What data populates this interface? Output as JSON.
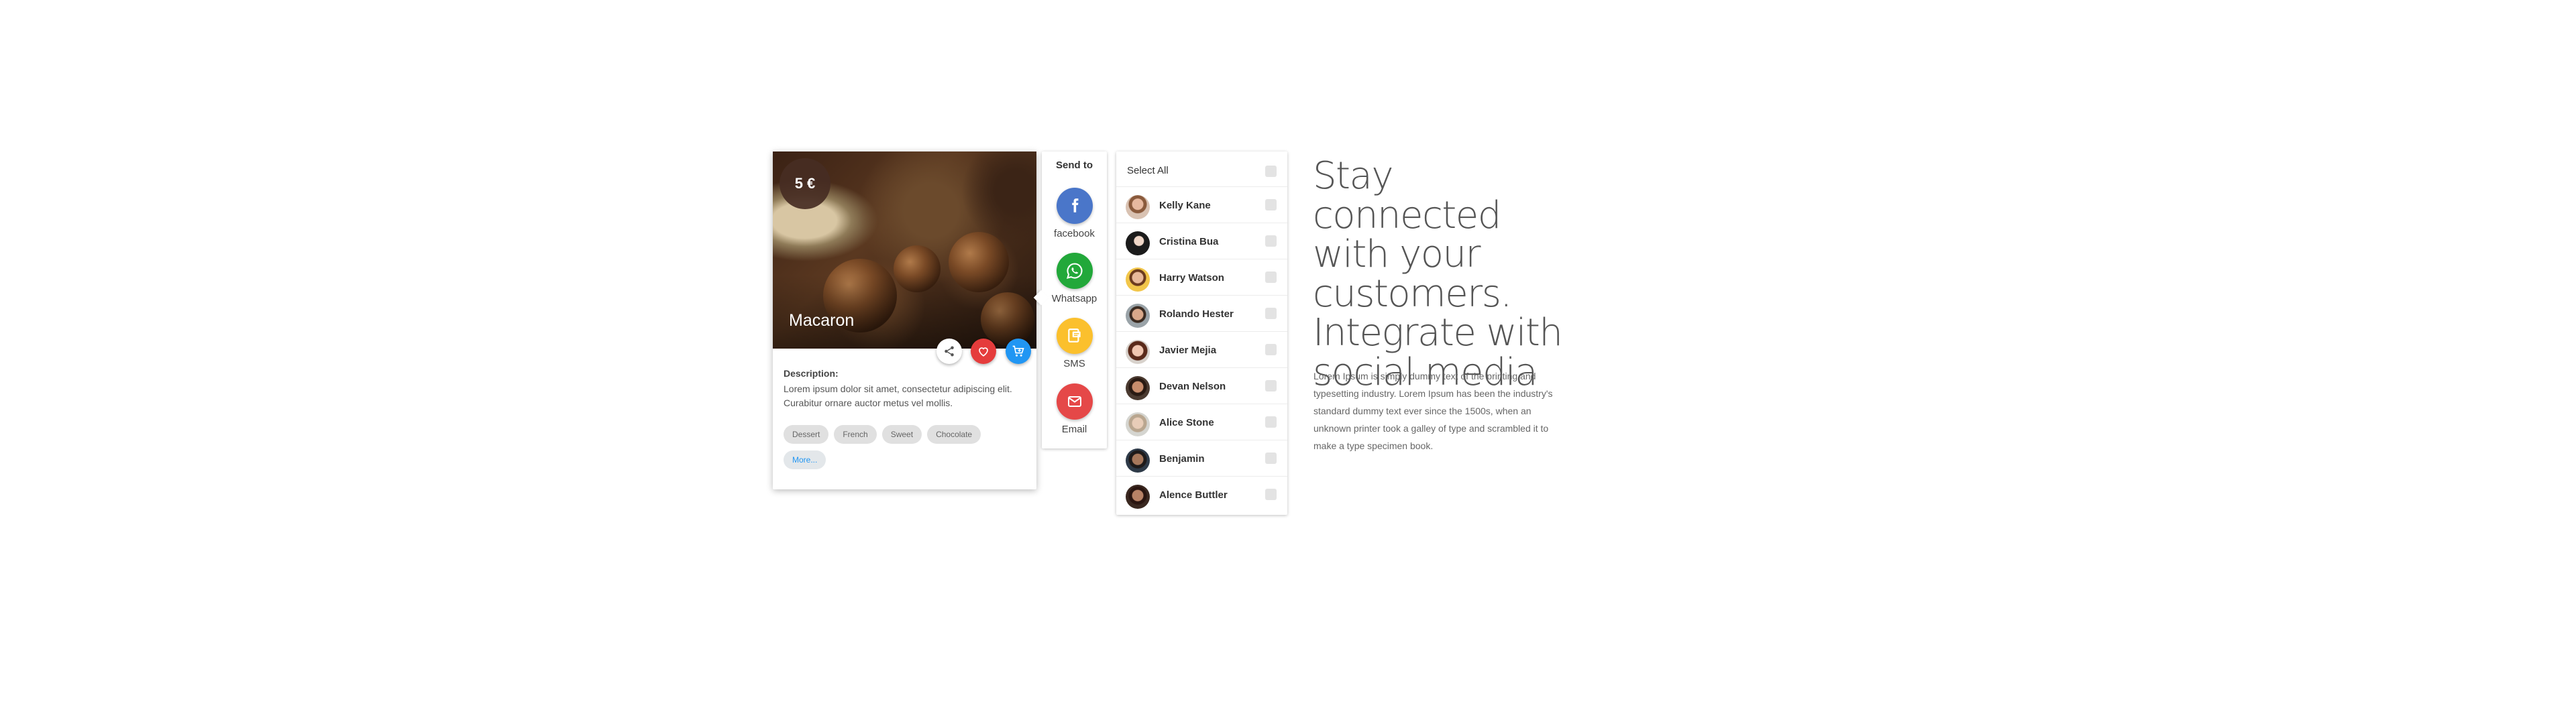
{
  "product": {
    "price": "5 €",
    "title": "Macaron",
    "description_label": "Description:",
    "description": "Lorem ipsum dolor sit amet, consectetur adipiscing elit. Curabitur ornare auctor metus vel mollis.",
    "tags": [
      "Dessert",
      "French",
      "Sweet",
      "Chocolate"
    ],
    "more_label": "More..."
  },
  "send_to": {
    "title": "Send to",
    "items": [
      {
        "label": "facebook",
        "icon": "facebook-icon",
        "color": "#4a76c9"
      },
      {
        "label": "Whatsapp",
        "icon": "whatsapp-icon",
        "color": "#22a83a"
      },
      {
        "label": "SMS",
        "icon": "sms-icon",
        "color": "#fbc02d"
      },
      {
        "label": "Email",
        "icon": "email-icon",
        "color": "#e54848"
      }
    ]
  },
  "contacts": {
    "select_all": "Select All",
    "people": [
      {
        "name": "Kelly Kane"
      },
      {
        "name": "Cristina Bua"
      },
      {
        "name": "Harry Watson"
      },
      {
        "name": "Rolando Hester"
      },
      {
        "name": "Javier Mejia"
      },
      {
        "name": "Devan Nelson"
      },
      {
        "name": "Alice Stone"
      },
      {
        "name": "Benjamin"
      },
      {
        "name": "Alence Buttler"
      }
    ]
  },
  "marketing": {
    "headline": "Stay connected with your customers. Integrate with social media",
    "body": "Lorem Ipsum is simply dummy text of the printing and typesetting industry. Lorem Ipsum has been the industry's standard dummy text ever since the 1500s, when an unknown printer took a galley of type and scrambled it to make a type specimen book."
  },
  "colors": {
    "accent_blue": "#2196f3",
    "favorite_red": "#e53c3c",
    "price_badge": "#462d23"
  }
}
